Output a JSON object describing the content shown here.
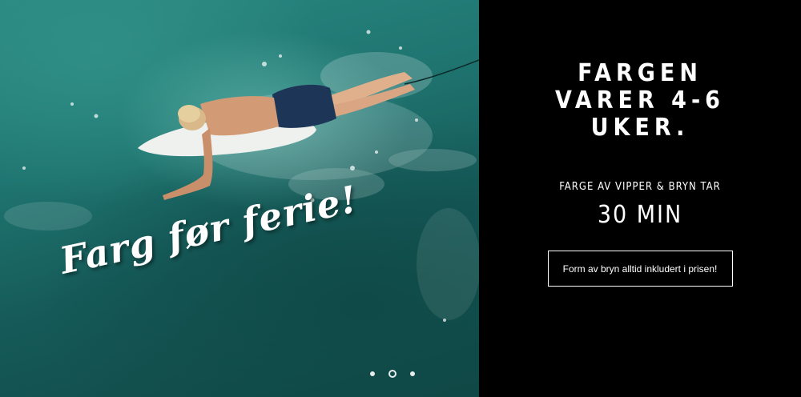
{
  "hero": {
    "caption": "Farg før ferie!",
    "slides": [
      {
        "label": "slide-1",
        "active": false
      },
      {
        "label": "slide-2",
        "active": true
      },
      {
        "label": "slide-3",
        "active": false
      }
    ]
  },
  "panel": {
    "headline": "FARGEN VARER 4-6 UKER.",
    "subhead": "FARGE AV VIPPER & BRYN TAR",
    "duration": "30 MIN",
    "cta_label": "Form av bryn alltid inkludert i prisen!"
  },
  "colors": {
    "panel_background": "#000000",
    "text": "#ffffff",
    "water": "#1f7470"
  }
}
